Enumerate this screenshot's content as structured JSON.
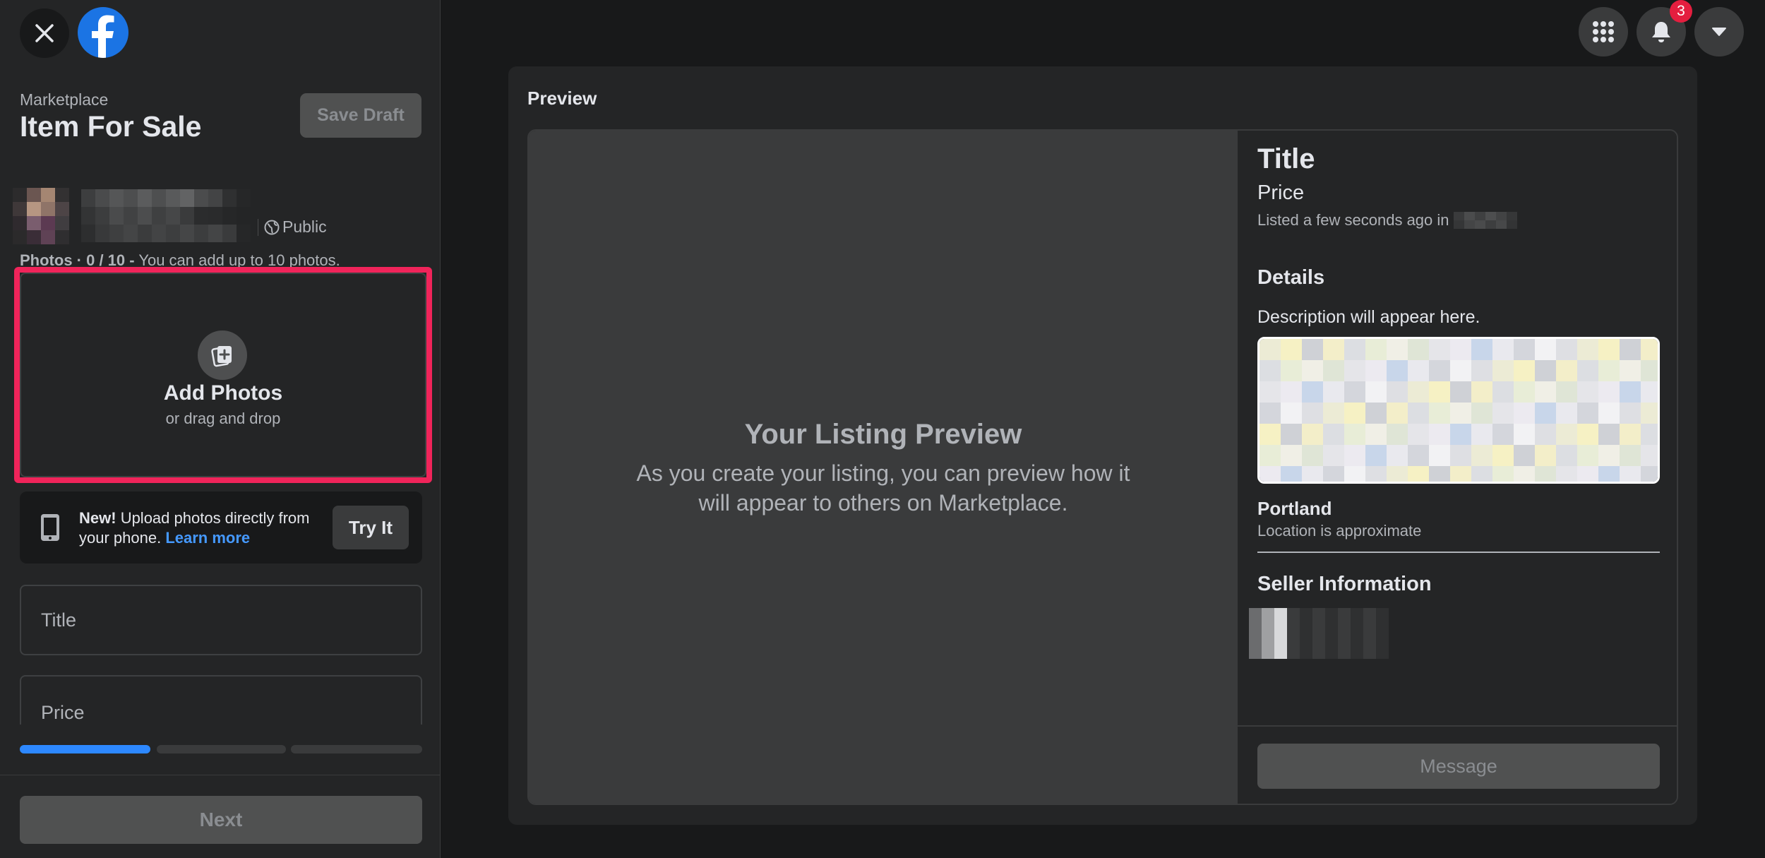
{
  "sidebar": {
    "breadcrumb": "Marketplace",
    "title": "Item For Sale",
    "save_draft_label": "Save Draft",
    "audience_label": "Public",
    "photos_info": {
      "label": "Photos · 0 / 10 -",
      "hint": "You can add up to 10 photos."
    },
    "add_photos": {
      "label": "Add Photos",
      "sub": "or drag and drop"
    },
    "phone_upload": {
      "new_label": "New!",
      "text": "Upload photos directly from your phone.",
      "link": "Learn more",
      "button": "Try It"
    },
    "fields": {
      "title_placeholder": "Title",
      "price_placeholder": "Price"
    },
    "progress_steps": [
      {
        "state": "active"
      },
      {
        "state": "inactive"
      },
      {
        "state": "inactive"
      }
    ],
    "next_label": "Next"
  },
  "topbar": {
    "menu_icon": "grid-menu-icon",
    "notifications_icon": "bell-icon",
    "notifications_count": "3",
    "account_icon": "caret-down-icon"
  },
  "preview": {
    "heading": "Preview",
    "placeholder_title": "Your Listing Preview",
    "placeholder_sub": "As you create your listing, you can preview how it will appear to others on Marketplace.",
    "listing": {
      "title": "Title",
      "price": "Price",
      "listed_text": "Listed a few seconds ago in",
      "details_heading": "Details",
      "description": "Description will appear here.",
      "city": "Portland",
      "location_note": "Location is approximate",
      "seller_heading": "Seller Information",
      "message_label": "Message"
    }
  },
  "colors": {
    "background": "#18191a",
    "panel": "#242526",
    "accent": "#2d88ff",
    "highlight": "#f0245a",
    "badge": "#e41e3f"
  }
}
